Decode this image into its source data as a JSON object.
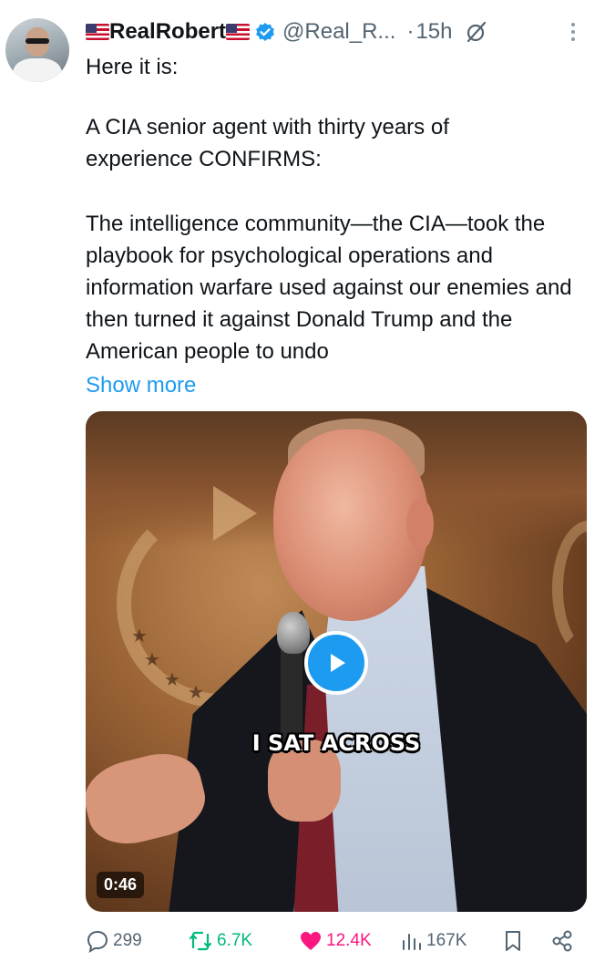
{
  "tweet": {
    "display_name": "RealRobert",
    "handle": "@Real_R...",
    "separator": "·",
    "time": "15h",
    "line_1": "Here it is:",
    "paragraph_2": "A CIA senior agent with thirty years of experience CONFIRMS:",
    "paragraph_3": "The intelligence community—the CIA—took the playbook for psychological operations and information warfare used against our enemies and then turned it against Donald Trump and the American people to undo",
    "show_more": "Show more"
  },
  "media": {
    "caption": "I SAT ACROSS",
    "duration": "0:46"
  },
  "actions": {
    "replies": "299",
    "reposts": "6.7K",
    "likes": "12.4K",
    "views": "167K"
  },
  "icons": {
    "verified": "verified-badge-icon",
    "grok": "grok-icon",
    "more": "more-options-icon",
    "play": "play-icon",
    "reply": "reply-icon",
    "repost": "repost-icon",
    "like": "heart-icon",
    "views": "views-icon",
    "bookmark": "bookmark-icon",
    "share": "share-icon"
  },
  "colors": {
    "accent": "#1d9bf0",
    "repost": "#00ba7c",
    "like": "#f91880",
    "muted": "#536471"
  }
}
